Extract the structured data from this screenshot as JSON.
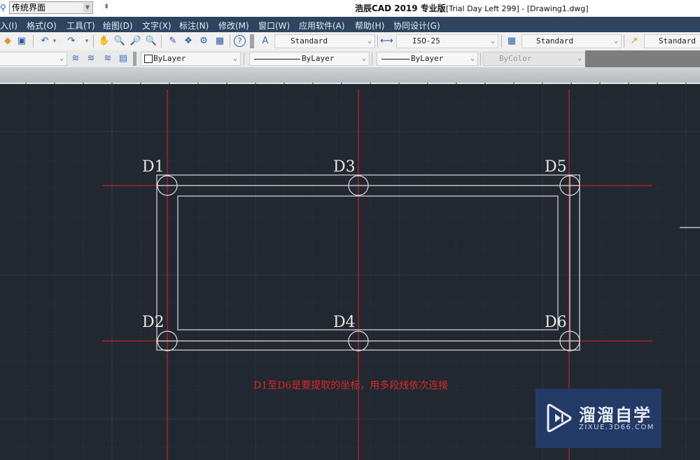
{
  "titlebar": {
    "workspace_value": "传统界面",
    "app_title": "浩辰CAD 2019 专业版",
    "app_subtitle": "[Trial Day Left 299] - [Drawing1.dwg]",
    "quick_access_glyph": "⇟"
  },
  "menubar": {
    "items": [
      {
        "label": "入(I)"
      },
      {
        "label": "格式(O)"
      },
      {
        "label": "工具(T)"
      },
      {
        "label": "绘图(D)"
      },
      {
        "label": "文字(X)"
      },
      {
        "label": "标注(N)"
      },
      {
        "label": "修改(M)"
      },
      {
        "label": "窗口(W)"
      },
      {
        "label": "应用软件(A)"
      },
      {
        "label": "帮助(H)"
      },
      {
        "label": "协同设计(G)"
      }
    ]
  },
  "toolbar1": {
    "icons": [
      {
        "name": "tag-icon",
        "glyph": "◆"
      },
      {
        "name": "publish-icon",
        "glyph": "▣"
      },
      {
        "name": "undo-icon",
        "glyph": "↶"
      },
      {
        "name": "undo-dropdown-icon",
        "glyph": "▾"
      },
      {
        "name": "redo-icon",
        "glyph": "↷"
      },
      {
        "name": "redo-dropdown-icon",
        "glyph": "▾"
      },
      {
        "name": "pan-hand-icon",
        "glyph": "✋"
      },
      {
        "name": "zoom-realtime-icon",
        "glyph": "🔍"
      },
      {
        "name": "zoom-window-icon",
        "glyph": "🔎"
      },
      {
        "name": "zoom-previous-icon",
        "glyph": "🔍"
      },
      {
        "name": "match-properties-icon",
        "glyph": "✎"
      },
      {
        "name": "design-center-icon",
        "glyph": "❖"
      },
      {
        "name": "settings-gears-icon",
        "glyph": "⚙"
      },
      {
        "name": "calculator-icon",
        "glyph": "▦"
      },
      {
        "name": "help-icon",
        "glyph": "?"
      }
    ],
    "text_style": "Standard",
    "dim_style": "ISO-25",
    "table_style": "Standard",
    "multileader_style": "Standard"
  },
  "toolbar2": {
    "layer_value": "",
    "layer_icons": [
      {
        "name": "layer-manager-icon",
        "glyph": "≋"
      },
      {
        "name": "layer-state-icon",
        "glyph": "≋"
      },
      {
        "name": "layer-previous-icon",
        "glyph": "≋"
      },
      {
        "name": "layer-match-icon",
        "glyph": "▤"
      }
    ],
    "color_value": "ByLayer",
    "linetype_value": "ByLayer",
    "lineweight_value": "ByLayer",
    "plotstyle_value": "ByColor"
  },
  "drawing": {
    "points": [
      {
        "label": "D1"
      },
      {
        "label": "D2"
      },
      {
        "label": "D3"
      },
      {
        "label": "D4"
      },
      {
        "label": "D5"
      },
      {
        "label": "D6"
      }
    ],
    "caption": "D1至D6是要提取的坐标，用多段线依次连接",
    "colors": {
      "background": "#212830",
      "axis": "#d01e2a",
      "geometry": "#e6e6e6",
      "caption": "#d8282c"
    }
  },
  "watermark": {
    "title": "溜溜自学",
    "url": "ZIXUE.3D66.COM"
  }
}
